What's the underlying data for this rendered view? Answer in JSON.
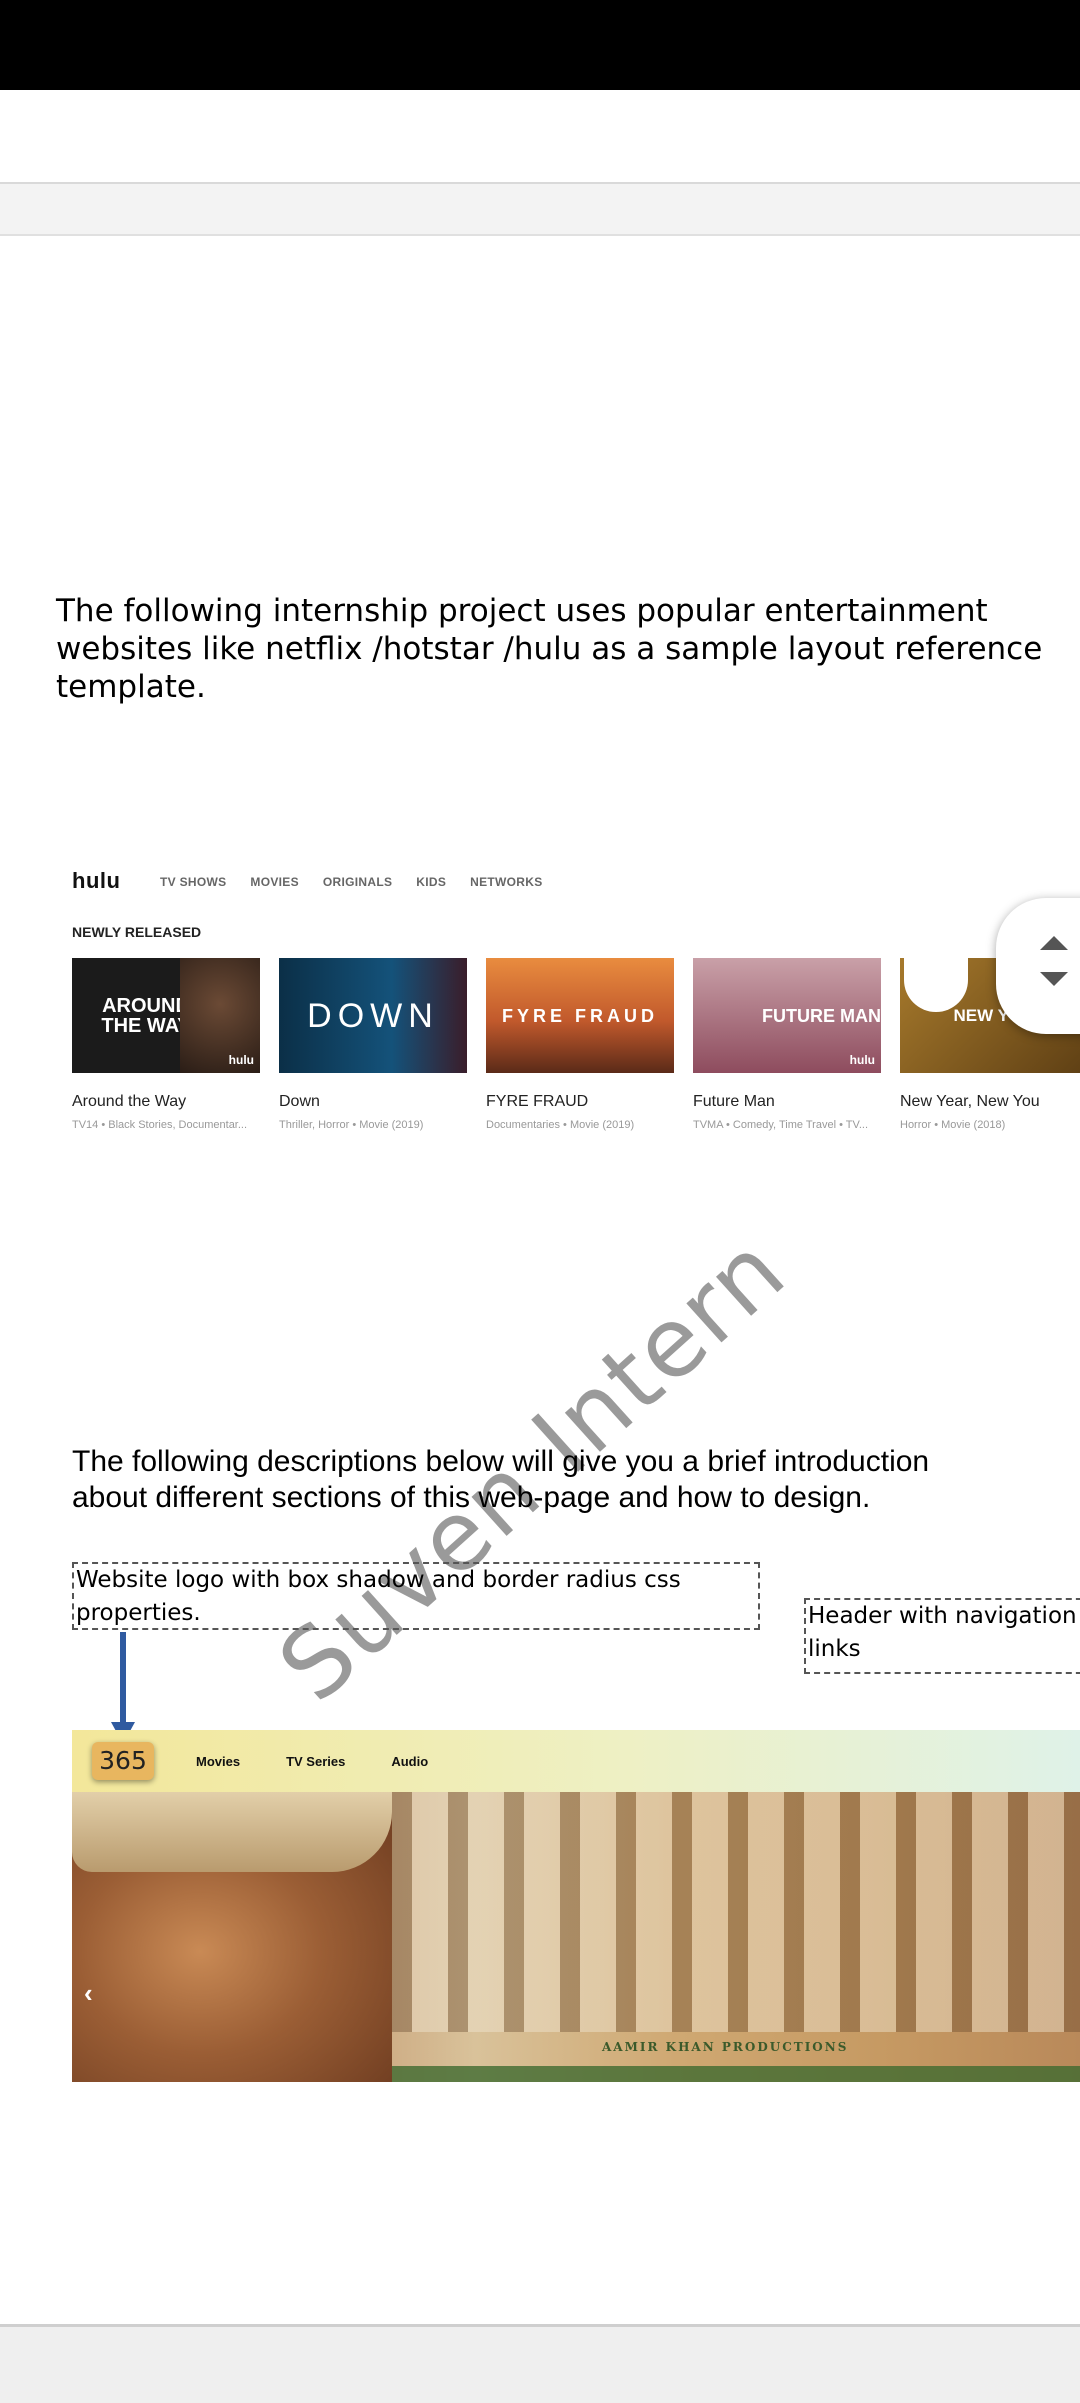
{
  "intro_lines": [
    "The following internship project uses popular entertainment",
    "websites like netflix /hotstar /hulu as a sample layout reference",
    "template."
  ],
  "hulu": {
    "logo": "hulu",
    "nav": [
      "TV SHOWS",
      "MOVIES",
      "ORIGINALS",
      "KIDS",
      "NETWORKS"
    ],
    "section_title": "NEWLY RELEASED",
    "tiles": [
      {
        "title": "Around the Way",
        "meta": "TV14 • Black Stories, Documentar...",
        "art": "AROUND THE WAY",
        "badge": "hulu",
        "color": "#1b1b1b"
      },
      {
        "title": "Down",
        "meta": "Thriller, Horror • Movie (2019)",
        "art": "DOWN",
        "badge": "",
        "color": "#0f3a58"
      },
      {
        "title": "FYRE FRAUD",
        "meta": "Documentaries • Movie (2019)",
        "art": "FYRE FRAUD",
        "badge": "",
        "color": "#d6763a"
      },
      {
        "title": "Future Man",
        "meta": "TVMA • Comedy, Time Travel • TV...",
        "art": "FUTURE MAN",
        "badge": "hulu",
        "color": "#9a5a6a"
      },
      {
        "title": "New Year, New You",
        "meta": "Horror • Movie (2018)",
        "art": "NEW YOU",
        "badge": "",
        "color": "#7a5a1e"
      }
    ]
  },
  "watermark": "Suven Intern",
  "desc_lines": [
    "The following descriptions below will give you a brief introduction",
    "about different sections of  this web-page and how to design."
  ],
  "annotations": {
    "logo_note": [
      "Website logo with box shadow and border radius css",
      "properties."
    ],
    "header_note": [
      "Header with navigation",
      "links"
    ]
  },
  "site": {
    "logo": "365",
    "nav": [
      "Movies",
      "TV Series",
      "Audio"
    ],
    "production_credit": "AAMIR KHAN PRODUCTIONS",
    "prev_arrow": "‹"
  }
}
